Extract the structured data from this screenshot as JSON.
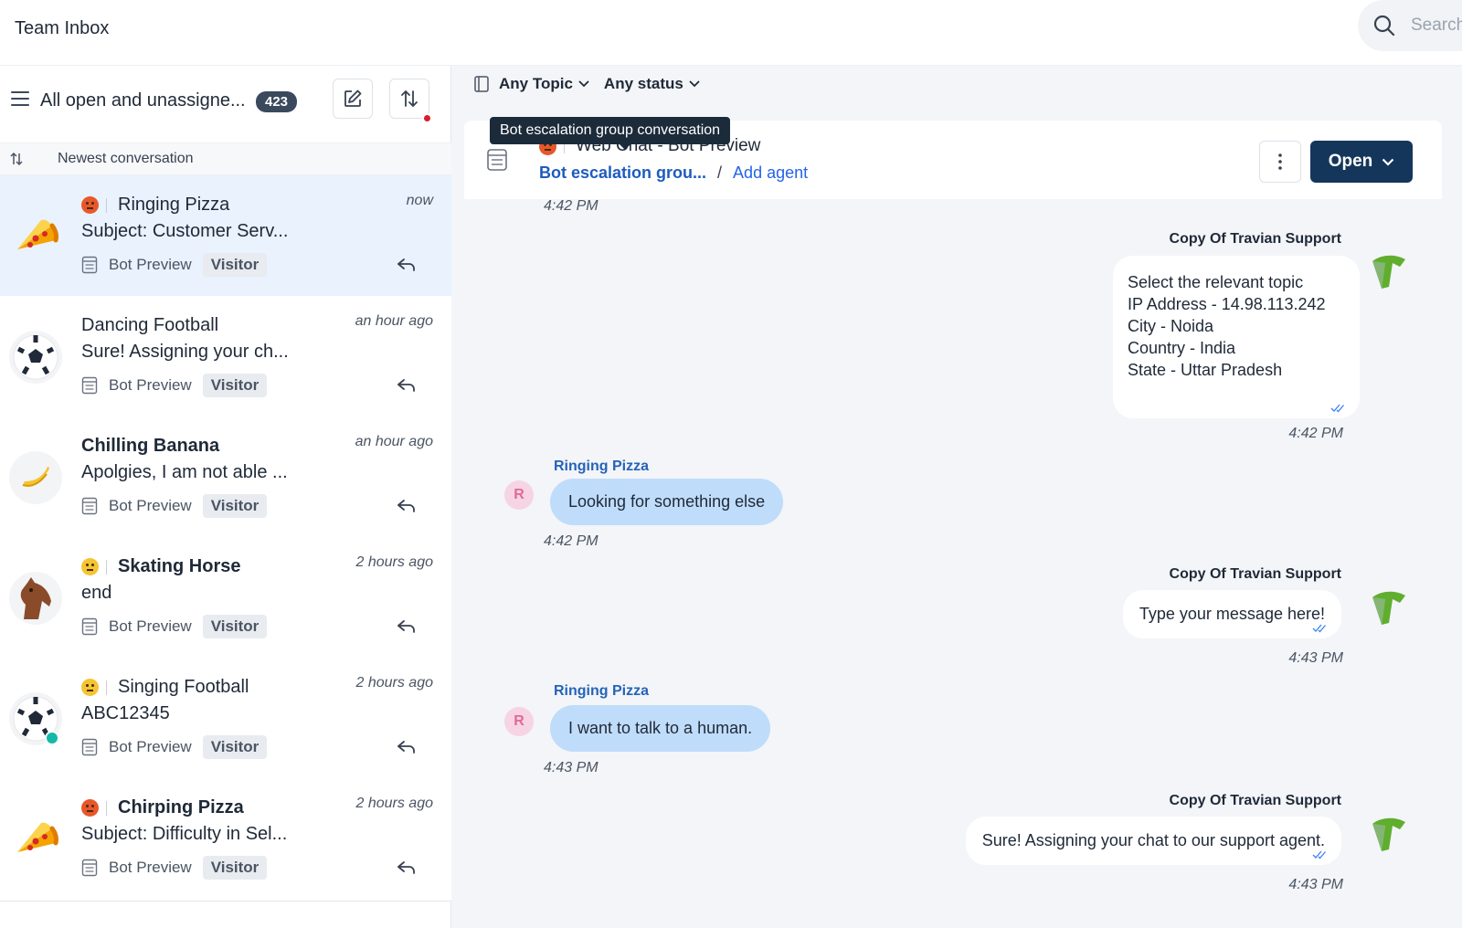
{
  "app": {
    "title": "Team Inbox"
  },
  "search": {
    "placeholder": "Search"
  },
  "inbox": {
    "view_title": "All open and unassigne...",
    "count": "423",
    "sort_label": "Newest conversation"
  },
  "conversations": [
    {
      "name": "Ringing Pizza",
      "mood": "angry",
      "time": "now",
      "preview": "Subject: Customer Serv...",
      "channel": "Bot Preview",
      "tag": "Visitor",
      "avatar": "pizza-icon",
      "active": true,
      "bold": false
    },
    {
      "name": "Dancing Football",
      "mood": "",
      "time": "an hour ago",
      "preview": "Sure! Assigning your ch...",
      "channel": "Bot Preview",
      "tag": "Visitor",
      "avatar": "football-icon",
      "active": false,
      "bold": false
    },
    {
      "name": "Chilling Banana",
      "mood": "",
      "time": "an hour ago",
      "preview": "Apolgies, I am not able ...",
      "channel": "Bot Preview",
      "tag": "Visitor",
      "avatar": "banana-icon",
      "active": false,
      "bold": true
    },
    {
      "name": "Skating Horse",
      "mood": "neutral",
      "time": "2 hours ago",
      "preview": "end",
      "channel": "Bot Preview",
      "tag": "Visitor",
      "avatar": "horse-icon",
      "active": false,
      "bold": true
    },
    {
      "name": "Singing Football",
      "mood": "neutral",
      "time": "2 hours ago",
      "preview": "ABC12345",
      "channel": "Bot Preview",
      "tag": "Visitor",
      "avatar": "football-icon",
      "active": false,
      "bold": false
    },
    {
      "name": "Chirping Pizza",
      "mood": "angry",
      "time": "2 hours ago",
      "preview": "Subject: Difficulty in Sel...",
      "channel": "Bot Preview",
      "tag": "Visitor",
      "avatar": "pizza-icon",
      "active": false,
      "bold": true
    }
  ],
  "filters": {
    "topic": "Any Topic",
    "status": "Any status"
  },
  "conversation": {
    "channel": "Web Chat - Bot Preview",
    "group": "Bot escalation grou...",
    "separator": "/",
    "add_agent": "Add agent",
    "status_button": "Open",
    "tooltip": "Bot escalation group conversation"
  },
  "messages": {
    "top_time": "4:42 PM",
    "m1": {
      "sender": "Copy Of Travian Support",
      "lines": [
        "Select the relevant topic",
        "IP Address - 14.98.113.242",
        "City - Noida",
        "Country - India",
        "State - Uttar Pradesh"
      ],
      "time": "4:42 PM"
    },
    "m2": {
      "sender": "Ringing Pizza",
      "initial": "R",
      "text": "Looking for something else",
      "time": "4:42 PM"
    },
    "m3": {
      "sender": "Copy Of Travian Support",
      "text": "Type your message here!",
      "time": "4:43 PM"
    },
    "m4": {
      "sender": "Ringing Pizza",
      "initial": "R",
      "text": "I want to talk to a human.",
      "time": "4:43 PM"
    },
    "m5": {
      "sender": "Copy Of Travian Support",
      "text": "Sure! Assigning your chat to our support agent.",
      "time": "4:43 PM"
    }
  },
  "colors": {
    "accent": "#15365b",
    "link": "#2563eb",
    "user_bubble": "#c0dcfb",
    "active_row": "#e9f2fd",
    "badge": "#3a4a5c"
  }
}
